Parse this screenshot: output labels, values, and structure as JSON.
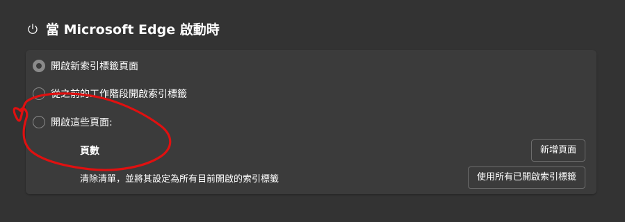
{
  "section": {
    "title": "當 Microsoft Edge 啟動時",
    "icon": "power-icon"
  },
  "options": [
    {
      "label": "開啟新索引標籤頁面",
      "checked": true
    },
    {
      "label": "從之前的工作階段開啟索引標籤",
      "checked": false
    },
    {
      "label": "開啟這些頁面:",
      "checked": false
    }
  ],
  "pages": {
    "label": "頁數",
    "add_button": "新增頁面",
    "clear_text": "清除清單，並將其設定為所有目前開啟的索引標籤",
    "use_all_button": "使用所有已開啟索引標籤"
  },
  "colors": {
    "background": "#333333",
    "card": "#3b3b3b",
    "annotation": "#e01010"
  }
}
